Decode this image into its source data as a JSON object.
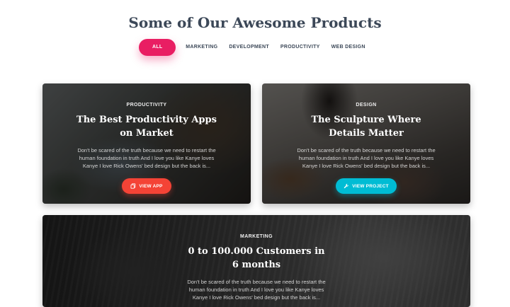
{
  "heading": "Some of Our Awesome Products",
  "filters": [
    {
      "label": "ALL",
      "active": true
    },
    {
      "label": "MARKETING"
    },
    {
      "label": "DEVELOPMENT"
    },
    {
      "label": "PRODUCTIVITY"
    },
    {
      "label": "WEB DESIGN"
    }
  ],
  "cards": [
    {
      "category": "PRODUCTIVITY",
      "title": "The Best Productivity Apps on Market",
      "description": "Don't be scared of the truth because we need to restart the human foundation in truth And I love you like Kanye loves Kanye I love Rick Owens' bed design but the back is...",
      "button": {
        "label": "VIEW APP",
        "icon": "copy-icon",
        "color": "#f44336"
      }
    },
    {
      "category": "DESIGN",
      "title": "The Sculpture Where Details Matter",
      "description": "Don't be scared of the truth because we need to restart the human foundation in truth And I love you like Kanye loves Kanye I love Rick Owens' bed design but the back is...",
      "button": {
        "label": "VIEW PROJECT",
        "icon": "wrench-icon",
        "color": "#00bcd4"
      }
    },
    {
      "category": "MARKETING",
      "title": "0 to 100.000 Customers in 6 months",
      "description": "Don't be scared of the truth because we need to restart the human foundation in truth And I love you like Kanye loves Kanye I love Rick Owens' bed design but the back is..."
    }
  ]
}
